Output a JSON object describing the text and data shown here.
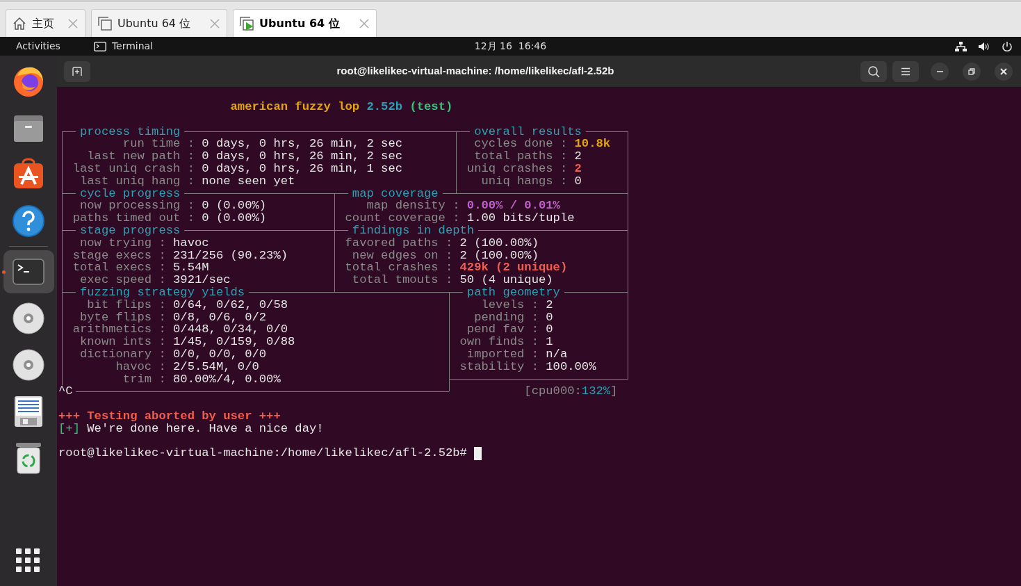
{
  "tabs": [
    {
      "label": "主页",
      "kind": "home",
      "selected": false
    },
    {
      "label": "Ubuntu 64 位",
      "kind": "vm",
      "selected": false
    },
    {
      "label": "Ubuntu 64 位",
      "kind": "vm-running",
      "selected": true
    }
  ],
  "topbar": {
    "activities": "Activities",
    "app": "Terminal",
    "clock": "12月 16  16:46"
  },
  "dock": [
    {
      "kind": "browser",
      "active": false
    },
    {
      "kind": "files",
      "active": false
    },
    {
      "kind": "software",
      "active": false
    },
    {
      "kind": "help",
      "active": false
    },
    {
      "kind": "terminal",
      "active": true
    },
    {
      "kind": "disc",
      "active": false
    },
    {
      "kind": "disc",
      "active": false
    },
    {
      "kind": "document",
      "active": false
    },
    {
      "kind": "trash",
      "active": false
    }
  ],
  "terminal": {
    "title": "root@likelikec-virtual-machine: /home/likelikec/afl-2.52b",
    "banner": [
      {
        "text": "american fuzzy lop",
        "color": "#e5a50a"
      },
      {
        "text": "2.52b",
        "color": "#2aa1b3"
      },
      {
        "text": "(test)",
        "color": "#33c47a"
      }
    ],
    "sections": [
      {
        "title": "process timing",
        "rows": [
          {
            "label": "run time :",
            "value": "0 days, 0 hrs, 26 min, 2 sec"
          },
          {
            "label": "last new path :",
            "value": "0 days, 0 hrs, 26 min, 2 sec"
          },
          {
            "label": "last uniq crash :",
            "value": "0 days, 0 hrs, 26 min, 1 sec"
          },
          {
            "label": "last uniq hang :",
            "value": "none seen yet"
          }
        ]
      },
      {
        "title": "overall results",
        "rows": [
          {
            "label": "cycles done :",
            "value": "10.8k",
            "color": "#e5a50a"
          },
          {
            "label": "total paths :",
            "value": "2"
          },
          {
            "label": "uniq crashes :",
            "value": "2",
            "color": "#f15d4f"
          },
          {
            "label": "uniq hangs :",
            "value": "0"
          }
        ]
      },
      {
        "title": "cycle progress",
        "rows": [
          {
            "label": "now processing :",
            "value": "0 (0.00%)"
          },
          {
            "label": "paths timed out :",
            "value": "0 (0.00%)"
          }
        ]
      },
      {
        "title": "map coverage",
        "rows": [
          {
            "label": "map density :",
            "value": "0.00% / 0.01%",
            "color": "#c061cb"
          },
          {
            "label": "count coverage :",
            "value": "1.00 bits/tuple"
          }
        ]
      },
      {
        "title": "stage progress",
        "rows": [
          {
            "label": "now trying :",
            "value": "havoc"
          },
          {
            "label": "stage execs :",
            "value": "231/256 (90.23%)"
          },
          {
            "label": "total execs :",
            "value": "5.54M"
          },
          {
            "label": "exec speed :",
            "value": "3921/sec"
          }
        ]
      },
      {
        "title": "findings in depth",
        "rows": [
          {
            "label": "favored paths :",
            "value": "2 (100.00%)"
          },
          {
            "label": "new edges on :",
            "value": "2 (100.00%)"
          },
          {
            "label": "total crashes :",
            "value": "429k (2 unique)",
            "color": "#f15d4f"
          },
          {
            "label": "total tmouts :",
            "value": "50 (4 unique)"
          }
        ]
      },
      {
        "title": "fuzzing strategy yields",
        "rows": [
          {
            "label": "bit flips :",
            "value": "0/64, 0/62, 0/58"
          },
          {
            "label": "byte flips :",
            "value": "0/8, 0/6, 0/2"
          },
          {
            "label": "arithmetics :",
            "value": "0/448, 0/34, 0/0"
          },
          {
            "label": "known ints :",
            "value": "1/45, 0/159, 0/88"
          },
          {
            "label": "dictionary :",
            "value": "0/0, 0/0, 0/0"
          },
          {
            "label": "havoc :",
            "value": "2/5.54M, 0/0"
          },
          {
            "label": "trim :",
            "value": "80.00%/4, 0.00%"
          }
        ]
      },
      {
        "title": "path geometry",
        "rows": [
          {
            "label": "levels :",
            "value": "2"
          },
          {
            "label": "pending :",
            "value": "0"
          },
          {
            "label": "pend fav :",
            "value": "0"
          },
          {
            "label": "own finds :",
            "value": "1"
          },
          {
            "label": "imported :",
            "value": "n/a"
          },
          {
            "label": "stability :",
            "value": "100.00%"
          }
        ]
      }
    ],
    "cpu": [
      {
        "text": "[cpu000:",
        "color": "#8a8a8a"
      },
      {
        "text": "132%",
        "color": "#2aa1b3"
      },
      {
        "text": "]",
        "color": "#8a8a8a"
      }
    ],
    "interrupt": "^C",
    "messages": [
      {
        "kind": "error",
        "text": "+++ Testing aborted by user +++"
      },
      {
        "kind": "info",
        "marker": "[+]",
        "text": "We're done here. Have a nice day!"
      }
    ],
    "prompt": "root@likelikec-virtual-machine:/home/likelikec/afl-2.52b#"
  }
}
